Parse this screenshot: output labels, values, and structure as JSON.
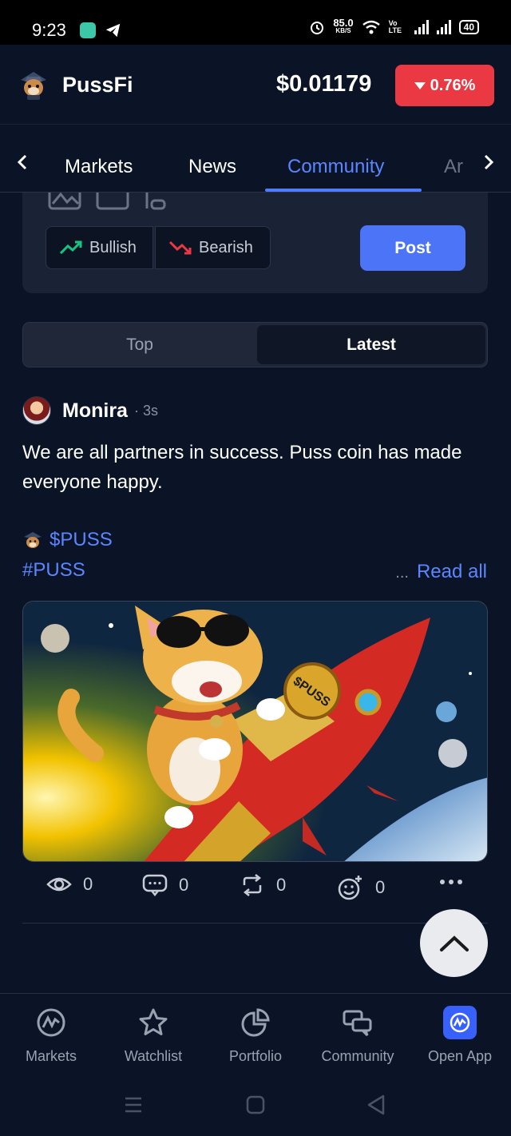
{
  "status_bar": {
    "time": "9:23",
    "net_speed_value": "85.0",
    "net_speed_unit": "KB/S",
    "volte": "Vo LTE",
    "battery": "40"
  },
  "header": {
    "token_name": "PussFi",
    "price": "$0.01179",
    "change": "0.76%",
    "change_direction": "down",
    "change_color": "#ea3943"
  },
  "tabs": {
    "items": [
      "Markets",
      "News",
      "Community",
      "Ar"
    ],
    "active": "Community",
    "accent": "#4f7cff"
  },
  "composer": {
    "bullish_label": "Bullish",
    "bearish_label": "Bearish",
    "post_label": "Post"
  },
  "sort": {
    "top_label": "Top",
    "latest_label": "Latest",
    "selected": "Latest"
  },
  "post": {
    "author": "Monira",
    "time": "· 3s",
    "body": "We are all partners in success. Puss coin has made everyone happy.",
    "token_tag": "$PUSS",
    "hashtag": "#PUSS",
    "read_more_dots": "...",
    "read_all_label": "Read all",
    "image_text": "$PUSS",
    "stats": {
      "views": "0",
      "comments": "0",
      "reposts": "0",
      "reactions": "0"
    }
  },
  "bottom_nav": {
    "items": [
      {
        "label": "Markets",
        "icon": "markets-icon"
      },
      {
        "label": "Watchlist",
        "icon": "star-icon"
      },
      {
        "label": "Portfolio",
        "icon": "pie-chart-icon"
      },
      {
        "label": "Community",
        "icon": "chat-bubbles-icon"
      },
      {
        "label": "Open App",
        "icon": "app-logo-icon"
      }
    ]
  }
}
